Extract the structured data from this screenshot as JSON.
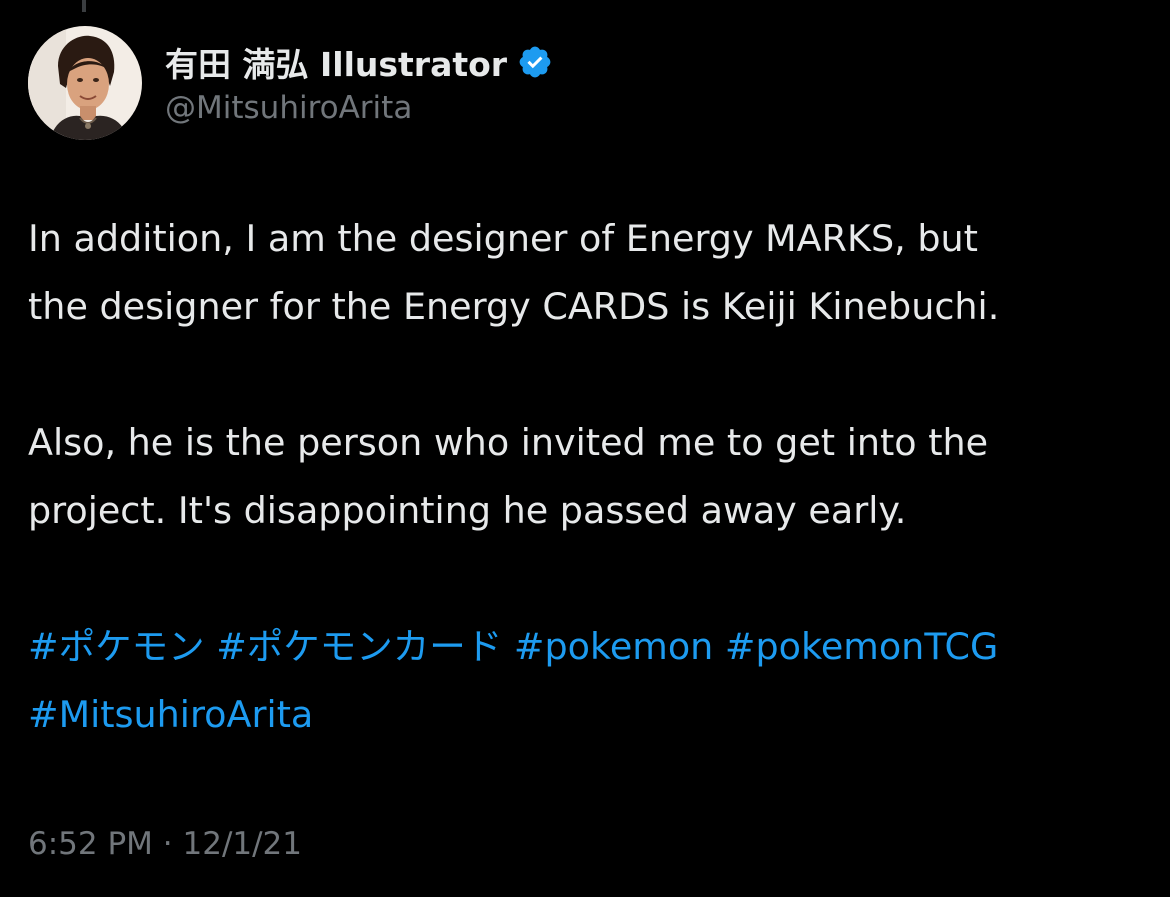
{
  "author": {
    "display_name": "有田 満弘 Illustrator",
    "handle": "@MitsuhiroArita",
    "verified_icon": "verified-badge-icon",
    "verified_color": "#1d9bf0"
  },
  "tweet": {
    "lines": [
      "In addition, I am the designer of  Energy MARKS, but",
      "the designer for the Energy CARDS is Keiji Kinebuchi.",
      "Also, he is the person who invited me to get into the",
      "project. It's disappointing he passed away early."
    ],
    "hashtags": [
      "#ポケモン",
      "#ポケモンカード",
      "#pokemon",
      "#pokemonTCG",
      "#MitsuhiroArita"
    ]
  },
  "meta": {
    "time": "6:52 PM",
    "separator": "·",
    "date": "12/1/21"
  },
  "colors": {
    "background": "#000000",
    "text": "#e7e9ea",
    "secondary": "#71767b",
    "link": "#1d9bf0"
  }
}
